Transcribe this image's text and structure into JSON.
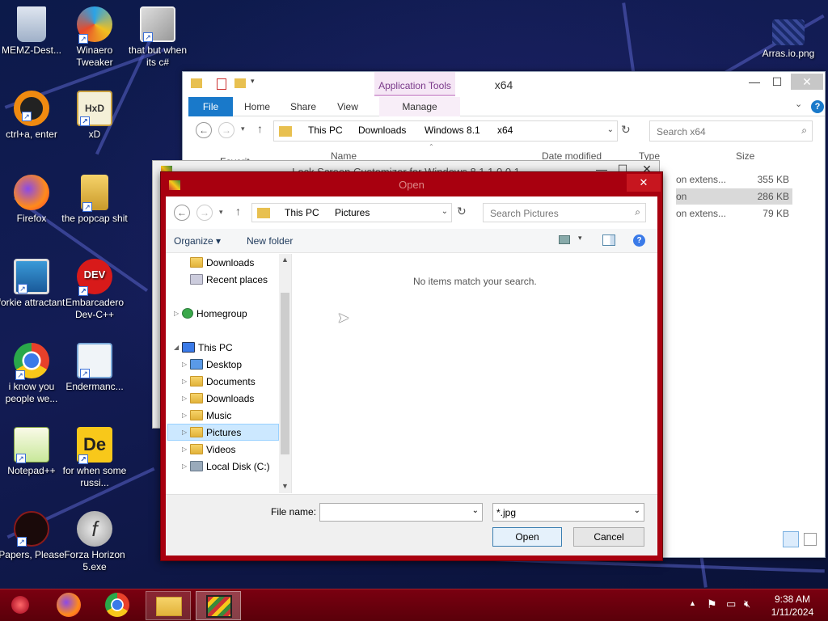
{
  "desktop": {
    "icons": [
      {
        "label": "MEMZ-Dest...",
        "icon": "recycle-bin-icon"
      },
      {
        "label": "Winaero Tweaker",
        "icon": "winaero-icon"
      },
      {
        "label": "that but when its c#",
        "icon": "windows-stack-icon"
      },
      {
        "label": "ctrl+a, enter",
        "icon": "ring-icon"
      },
      {
        "label": "xD",
        "icon": "hxd-icon"
      },
      {
        "label": "Firefox",
        "icon": "firefox-icon"
      },
      {
        "label": "the popcap shit",
        "icon": "popcap-icon"
      },
      {
        "label": "forkie attractant",
        "icon": "monitor-gear-icon"
      },
      {
        "label": "Embarcadero Dev-C++",
        "icon": "devcpp-icon"
      },
      {
        "label": "i know you people we...",
        "icon": "chrome-icon"
      },
      {
        "label": "Endermanc...",
        "icon": "window-app-icon"
      },
      {
        "label": "Notepad++",
        "icon": "notepadpp-icon"
      },
      {
        "label": "for when some russi...",
        "icon": "de-icon"
      },
      {
        "label": "Papers, Please",
        "icon": "papers-please-icon"
      },
      {
        "label": "Forza Horizon 5.exe",
        "icon": "flash-icon"
      },
      {
        "label": "Arras.io.png",
        "icon": "image-file-icon"
      }
    ]
  },
  "explorer": {
    "title": "x64",
    "app_tools": "Application Tools",
    "tabs": {
      "file": "File",
      "home": "Home",
      "share": "Share",
      "view": "View",
      "manage": "Manage"
    },
    "breadcrumbs": [
      "This PC",
      "Downloads",
      "Windows 8.1",
      "x64"
    ],
    "search_placeholder": "Search x64",
    "columns": {
      "name": "Name",
      "date": "Date modified",
      "type": "Type",
      "size": "Size"
    },
    "rows": [
      {
        "type": "on extens...",
        "size": "355 KB"
      },
      {
        "type": "on",
        "size": "286 KB"
      },
      {
        "type": "on extens...",
        "size": "79 KB"
      }
    ],
    "nav_partial": "Favorit..."
  },
  "lockscreen": {
    "title": "Lock Screen Customizer for Windows 8.1 1.0.0.1"
  },
  "dialog": {
    "title": "Open",
    "breadcrumbs": [
      "This PC",
      "Pictures"
    ],
    "search_placeholder": "Search Pictures",
    "organize": "Organize",
    "new_folder": "New folder",
    "empty_message": "No items match your search.",
    "nav": [
      {
        "label": "Downloads"
      },
      {
        "label": "Recent places"
      },
      {
        "label": "Homegroup"
      },
      {
        "label": "This PC"
      },
      {
        "label": "Desktop"
      },
      {
        "label": "Documents"
      },
      {
        "label": "Downloads"
      },
      {
        "label": "Music"
      },
      {
        "label": "Pictures"
      },
      {
        "label": "Videos"
      },
      {
        "label": "Local Disk (C:)"
      }
    ],
    "file_name_label": "File name:",
    "file_name_value": "",
    "filter_value": "*.jpg",
    "open_label": "Open",
    "cancel_label": "Cancel"
  },
  "taskbar": {
    "time": "9:38 AM",
    "date": "1/11/2024"
  }
}
